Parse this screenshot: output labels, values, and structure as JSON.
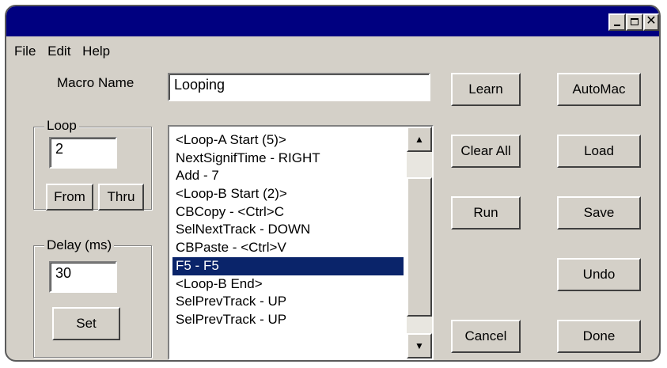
{
  "menu": {
    "file": "File",
    "edit": "Edit",
    "help": "Help"
  },
  "window_buttons": {
    "minimize": "minimize-icon",
    "maximize": "maximize-icon",
    "close": "close-icon"
  },
  "macro_name": {
    "label": "Macro Name",
    "value": "Looping"
  },
  "loop": {
    "title": "Loop",
    "value": "2",
    "from_label": "From",
    "thru_label": "Thru"
  },
  "delay": {
    "title": "Delay (ms)",
    "value": "30",
    "set_label": "Set"
  },
  "macro_steps": [
    "<Loop-A Start (5)>",
    "NextSignifTime - RIGHT",
    "Add - 7",
    "<Loop-B Start (2)>",
    "CBCopy - <Ctrl>C",
    "SelNextTrack - DOWN",
    "CBPaste - <Ctrl>V",
    "F5 - F5",
    "<Loop-B End>",
    "SelPrevTrack - UP",
    "SelPrevTrack - UP"
  ],
  "selected_step_index": 7,
  "buttons": {
    "learn": "Learn",
    "clear_all": "Clear All",
    "run": "Run",
    "cancel": "Cancel",
    "automac": "AutoMac",
    "load": "Load",
    "save": "Save",
    "undo": "Undo",
    "done": "Done"
  },
  "colors": {
    "titlebar": "#000080",
    "selection": "#0a246a",
    "face": "#d4d0c8"
  }
}
